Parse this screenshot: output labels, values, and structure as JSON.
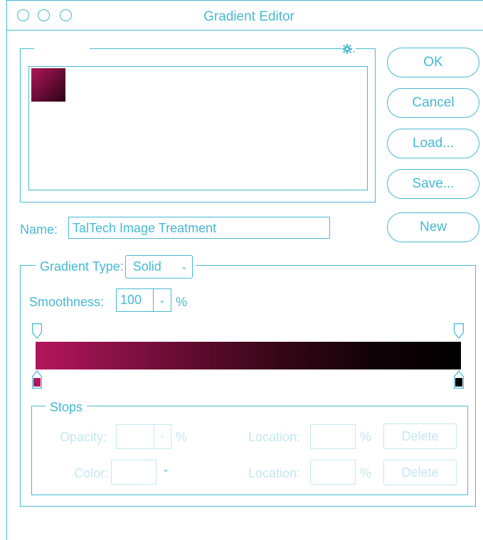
{
  "window": {
    "title": "Gradient Editor"
  },
  "buttons": {
    "ok": "OK",
    "cancel": "Cancel",
    "load": "Load...",
    "save": "Save...",
    "new": "New"
  },
  "name": {
    "label": "Name:",
    "value": "TalTech Image Treatment"
  },
  "gradient_type": {
    "label": "Gradient Type:",
    "value": "Solid"
  },
  "smoothness": {
    "label": "Smoothness:",
    "value": "100",
    "unit": "%"
  },
  "gradient": {
    "start_color": "#b4165c",
    "end_color": "#000000"
  },
  "stops": {
    "title": "Stops",
    "opacity_label": "Opacity:",
    "opacity_unit": "%",
    "color_label": "Color:",
    "location_label": "Location:",
    "location_unit": "%",
    "delete_label": "Delete"
  },
  "colors": {
    "accent": "#46b9d4",
    "disabled": "#c4e8f1"
  }
}
